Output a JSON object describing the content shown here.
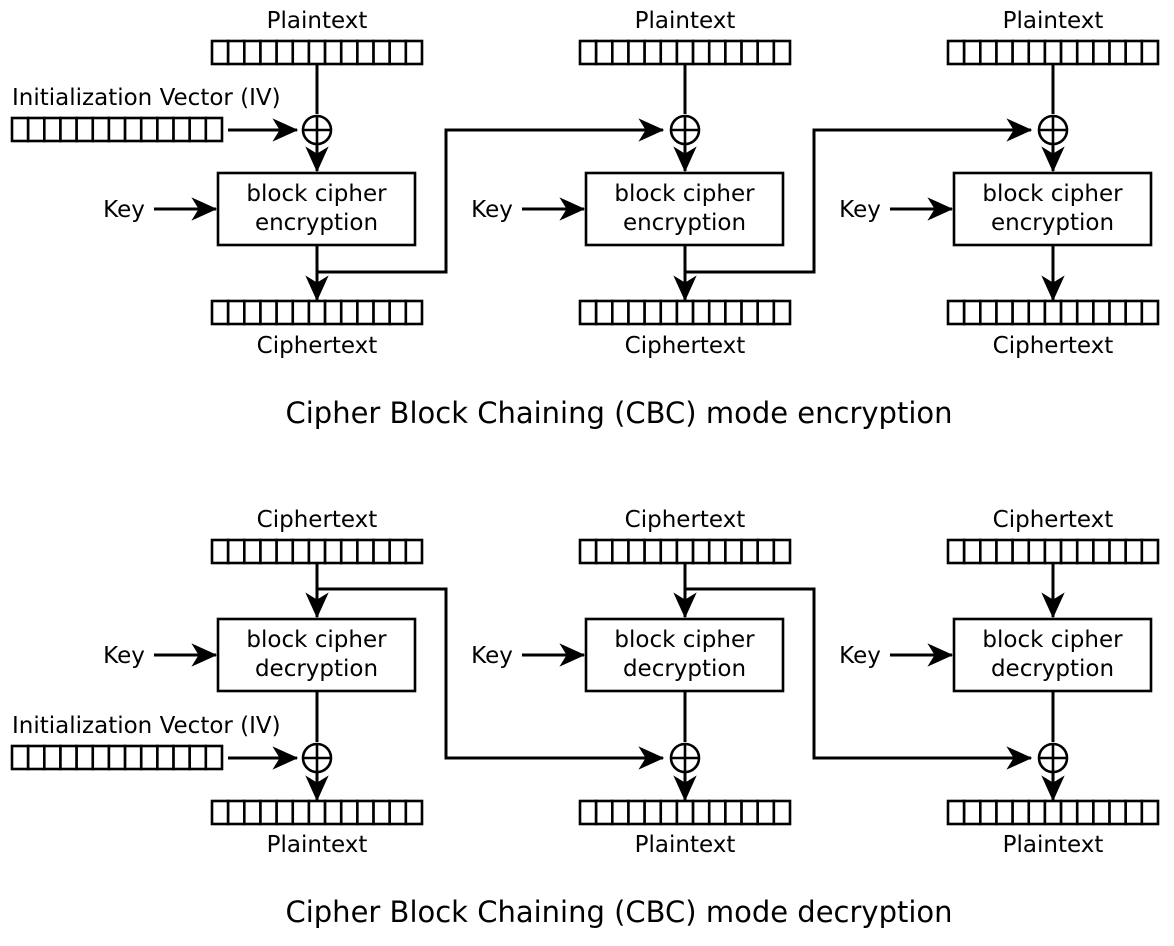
{
  "figure": {
    "title_top": "Cipher Block Chaining (CBC) mode encryption",
    "title_bottom": "Cipher Block Chaining (CBC) mode decryption",
    "bit_cells_per_array": 13,
    "colors": {
      "stroke": "#000000",
      "fill": "#ffffff",
      "background": "#ffffff"
    }
  },
  "labels": {
    "plaintext": "Plaintext",
    "ciphertext": "Ciphertext",
    "key": "Key",
    "iv": "Initialization Vector (IV)",
    "block_cipher": "block cipher",
    "encryption": "encryption",
    "decryption": "decryption",
    "xor": "xor-operator"
  },
  "encryption": {
    "caption": "Cipher Block Chaining (CBC) mode encryption",
    "iv_label": "Initialization Vector (IV)",
    "blocks": [
      {
        "index": 1,
        "input_label": "Plaintext",
        "key_label": "Key",
        "box_line1": "block cipher",
        "box_line2": "encryption",
        "output_label": "Ciphertext",
        "has_iv_input": true,
        "chains_out": true
      },
      {
        "index": 2,
        "input_label": "Plaintext",
        "key_label": "Key",
        "box_line1": "block cipher",
        "box_line2": "encryption",
        "output_label": "Ciphertext",
        "has_iv_input": false,
        "chains_out": true
      },
      {
        "index": 3,
        "input_label": "Plaintext",
        "key_label": "Key",
        "box_line1": "block cipher",
        "box_line2": "encryption",
        "output_label": "Ciphertext",
        "has_iv_input": false,
        "chains_out": false
      }
    ]
  },
  "decryption": {
    "caption": "Cipher Block Chaining (CBC) mode decryption",
    "iv_label": "Initialization Vector (IV)",
    "blocks": [
      {
        "index": 1,
        "input_label": "Ciphertext",
        "key_label": "Key",
        "box_line1": "block cipher",
        "box_line2": "decryption",
        "output_label": "Plaintext",
        "has_iv_input": true,
        "chains_out": true
      },
      {
        "index": 2,
        "input_label": "Ciphertext",
        "key_label": "Key",
        "box_line1": "block cipher",
        "box_line2": "decryption",
        "output_label": "Plaintext",
        "has_iv_input": false,
        "chains_out": true
      },
      {
        "index": 3,
        "input_label": "Ciphertext",
        "key_label": "Key",
        "box_line1": "block cipher",
        "box_line2": "decryption",
        "output_label": "Plaintext",
        "has_iv_input": false,
        "chains_out": false
      }
    ]
  }
}
